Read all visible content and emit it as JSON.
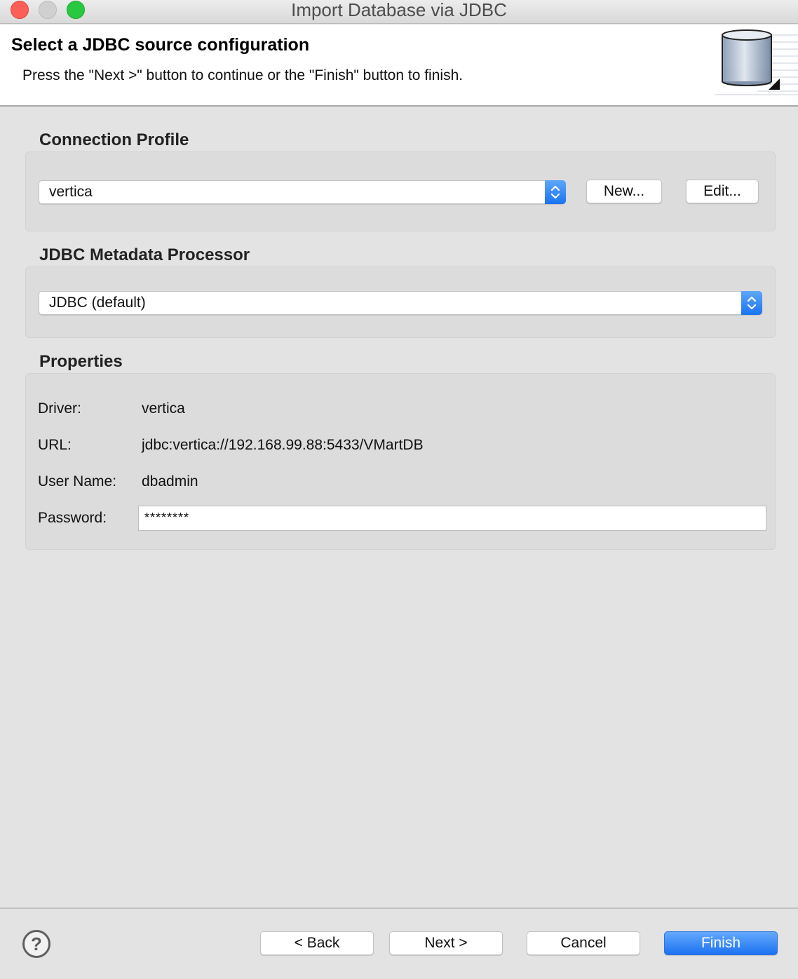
{
  "window": {
    "title": "Import Database via JDBC"
  },
  "banner": {
    "title": "Select a JDBC source configuration",
    "description": "Press the \"Next >\" button to continue or the \"Finish\" button to finish.",
    "image_icon": "database-cylinder-icon"
  },
  "connection_profile": {
    "heading": "Connection Profile",
    "selected": "vertica",
    "new_label": "New...",
    "edit_label": "Edit..."
  },
  "metadata_processor": {
    "heading": "JDBC Metadata Processor",
    "selected": "JDBC (default)"
  },
  "properties": {
    "heading": "Properties",
    "driver_label": "Driver:",
    "driver_value": "vertica",
    "url_label": "URL:",
    "url_value": "jdbc:vertica://192.168.99.88:5433/VMartDB",
    "username_label": "User Name:",
    "username_value": "dbadmin",
    "password_label": "Password:",
    "password_value": "********"
  },
  "footer": {
    "help_icon": "help-icon",
    "help_glyph": "?",
    "back_label": "< Back",
    "next_label": "Next >",
    "cancel_label": "Cancel",
    "finish_label": "Finish"
  },
  "colors": {
    "accent": "#1c72f2",
    "close": "#fc5f57",
    "maximize": "#28c840"
  }
}
